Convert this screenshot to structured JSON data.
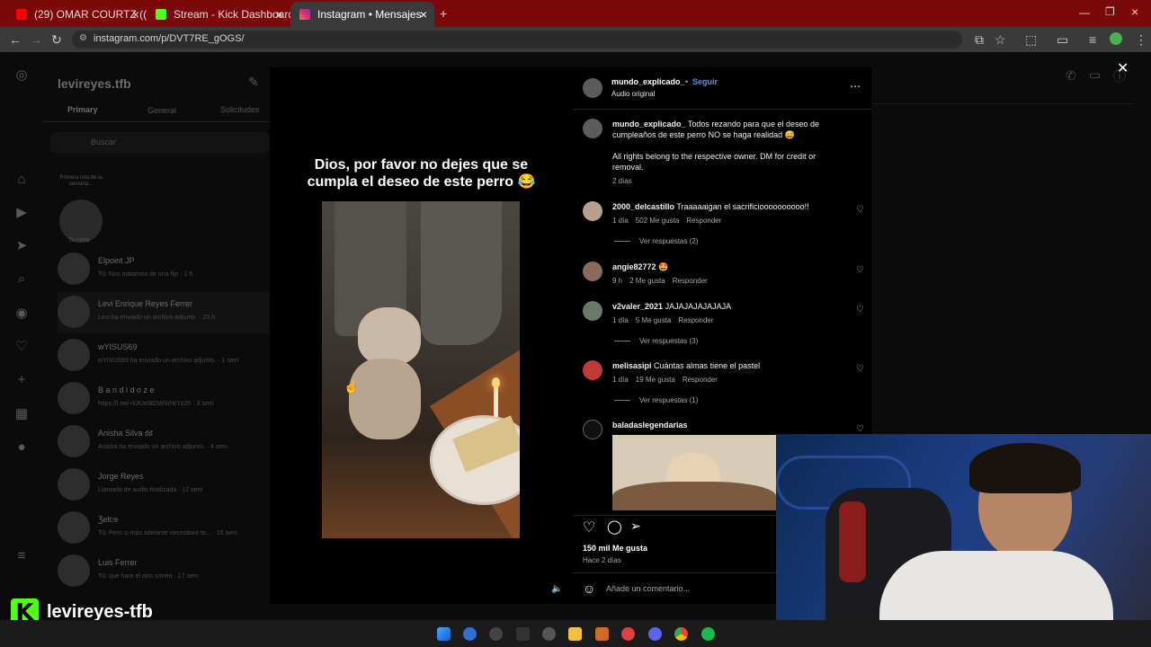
{
  "browser": {
    "tabs": [
      {
        "title": "(29) OMAR COURTZ ((ousi)) X",
        "favicon": "youtube-icon"
      },
      {
        "title": "Stream - Kick Dashboard",
        "favicon": "kick-icon"
      },
      {
        "title": "Instagram • Mensajes",
        "favicon": "instagram-icon"
      }
    ],
    "url": "instagram.com/p/DVT7RE_gOGS/"
  },
  "inbox": {
    "username": "levireyes.tfb",
    "tabs": [
      "Primary",
      "General",
      "Solicitudes"
    ],
    "search_placeholder": "Buscar",
    "note": {
      "text": "Primera rola de la semana...",
      "label": "Tu nota"
    },
    "threads": [
      {
        "name": "Elpoint JP",
        "preview": "Tú: Nos matamos de una fijo · 1 h"
      },
      {
        "name": "Levi Enrique Reyes Ferrer",
        "preview": "Levi ha enviado un archivo adjunto. · 23 h"
      },
      {
        "name": "wYISUS69",
        "preview": "wYISUS69 ha enviado un archivo adjunto. · 1 sem"
      },
      {
        "name": "B a n d i d o z e",
        "preview": "https://l.ne/+k3UeIBDWSrhkYz2h · 3 sem"
      },
      {
        "name": "Anisha Silva ♯♯",
        "preview": "Anisha ha enviado un archivo adjunto. · 4 sem"
      },
      {
        "name": "Jorge Reyes",
        "preview": "Llamada de audio finalizada · 12 sem"
      },
      {
        "name": "Ʒelcɘ",
        "preview": "Tú: Pero si más adelante necesitaré te... · 15 sem"
      },
      {
        "name": "Luis Ferrer",
        "preview": "Tú: que hare el otro sorteo · 17 sem"
      }
    ]
  },
  "post": {
    "caption": "Dios, por favor no dejes que se cumpla el deseo de este perro 😂",
    "author": "mundo_explicado_",
    "follow_label": "Seguir",
    "audio": "Audio original",
    "description": "Todos rezando para que el deseo de cumpleaños de este perro NO se haga realidad 😅",
    "credit": "All rights belong to the respective owner. DM for credit or removal.",
    "posted_ago": "2 días",
    "likes": "150 mil Me gusta",
    "date": "Hace 2 días",
    "comment_placeholder": "Añade un comentario..."
  },
  "comments": [
    {
      "user": "2000_delcastillo",
      "text": "Traaaaaigan el sacrificioooooooooo!!",
      "time": "1 día",
      "likes": "502 Me gusta",
      "reply": "Responder",
      "replies": "Ver respuestas (2)"
    },
    {
      "user": "angie82772",
      "text": "🤩",
      "time": "9 h",
      "likes": "2 Me gusta",
      "reply": "Responder",
      "replies": ""
    },
    {
      "user": "v2valer_2021",
      "text": "JAJAJAJAJAJAJA",
      "time": "1 día",
      "likes": "5 Me gusta",
      "reply": "Responder",
      "replies": "Ver respuestas (3)"
    },
    {
      "user": "melisasipi",
      "text": "Cuántas almas tiene el pastel",
      "time": "1 día",
      "likes": "19 Me gusta",
      "reply": "Responder",
      "replies": "Ver respuestas (1)"
    },
    {
      "user": "baladaslegendarias",
      "text": "",
      "time": "",
      "likes": "",
      "reply": "",
      "replies": ""
    }
  ],
  "stream_overlay": {
    "channel": "levireyes-tfb",
    "brand_color": "#53fc18"
  },
  "colors": {
    "tabbar": "#7a0a0a",
    "follow": "#5b8cff"
  }
}
